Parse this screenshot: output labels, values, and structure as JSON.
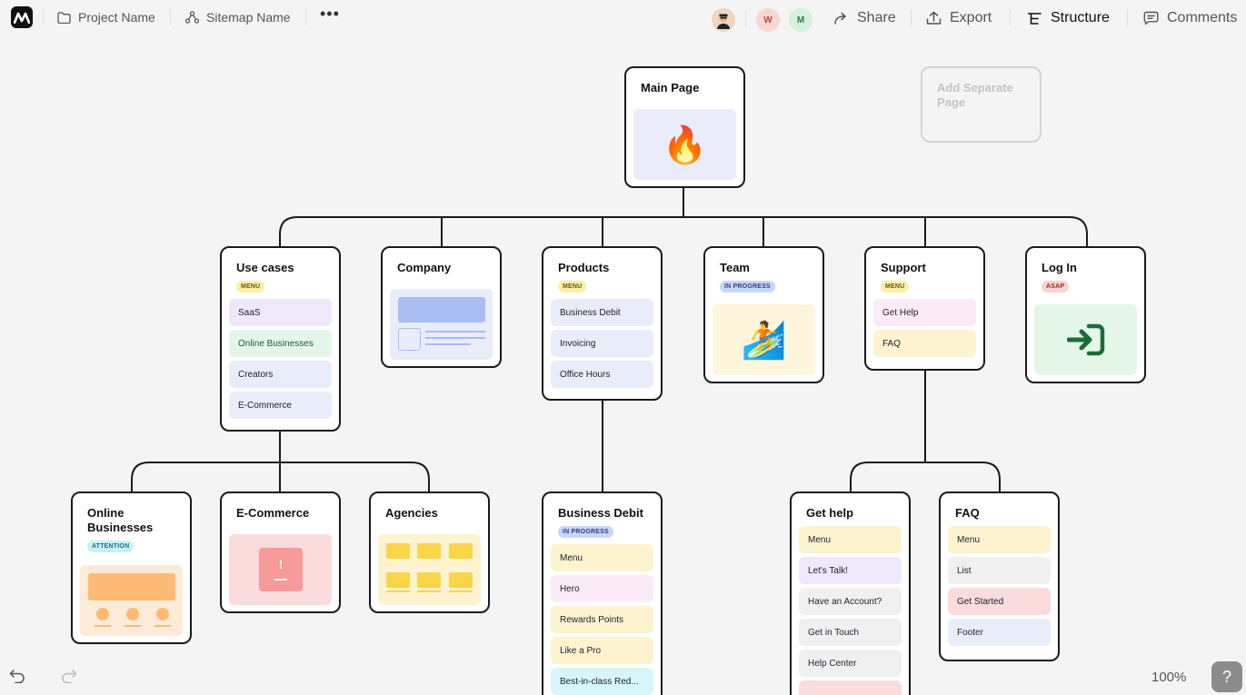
{
  "topbar": {
    "project_name": "Project Name",
    "sitemap_name": "Sitemap Name",
    "share": "Share",
    "export": "Export",
    "structure": "Structure",
    "comments": "Comments",
    "avatars": [
      {
        "initial": "W",
        "color": "#f8d7d5",
        "text_color": "#c0433a"
      },
      {
        "initial": "M",
        "color": "#d5f0dc",
        "text_color": "#2f7d45"
      }
    ]
  },
  "canvas": {
    "main_page": {
      "title": "Main Page",
      "emoji": "🔥"
    },
    "add_separate": "Add Separate Page",
    "level1": [
      {
        "title": "Use cases",
        "badge": "MENU",
        "items": [
          "SaaS",
          "Online Businesses",
          "Creators",
          "E-Commerce"
        ]
      },
      {
        "title": "Company"
      },
      {
        "title": "Products",
        "badge": "MENU",
        "items": [
          "Business Debit",
          "Invoicing",
          "Office Hours"
        ]
      },
      {
        "title": "Team",
        "badge": "IN PROGRESS",
        "emoji": "🏄"
      },
      {
        "title": "Support",
        "badge": "MENU",
        "items": [
          "Get Help",
          "FAQ"
        ]
      },
      {
        "title": "Log In",
        "badge": "ASAP"
      }
    ],
    "level2": [
      {
        "title": "Online Businesses",
        "badge": "ATTENTION"
      },
      {
        "title": "E-Commerce",
        "glyph": "!"
      },
      {
        "title": "Agencies"
      },
      {
        "title": "Business Debit",
        "badge": "IN PROGRESS",
        "items": [
          "Menu",
          "Hero",
          "Rewards Points",
          "Like a Pro",
          "Best-in-class Red..."
        ]
      },
      {
        "title": "Get help",
        "items": [
          "Menu",
          "Let's Talk!",
          "Have an Account?",
          "Get in Touch",
          "Help Center"
        ]
      },
      {
        "title": "FAQ",
        "items": [
          "Menu",
          "List",
          "Get Started",
          "Footer"
        ]
      }
    ]
  },
  "footer": {
    "zoom": "100%",
    "help": "?"
  },
  "colors": {
    "border": "#1a1a1a",
    "canvas": "#f4f4f4"
  }
}
